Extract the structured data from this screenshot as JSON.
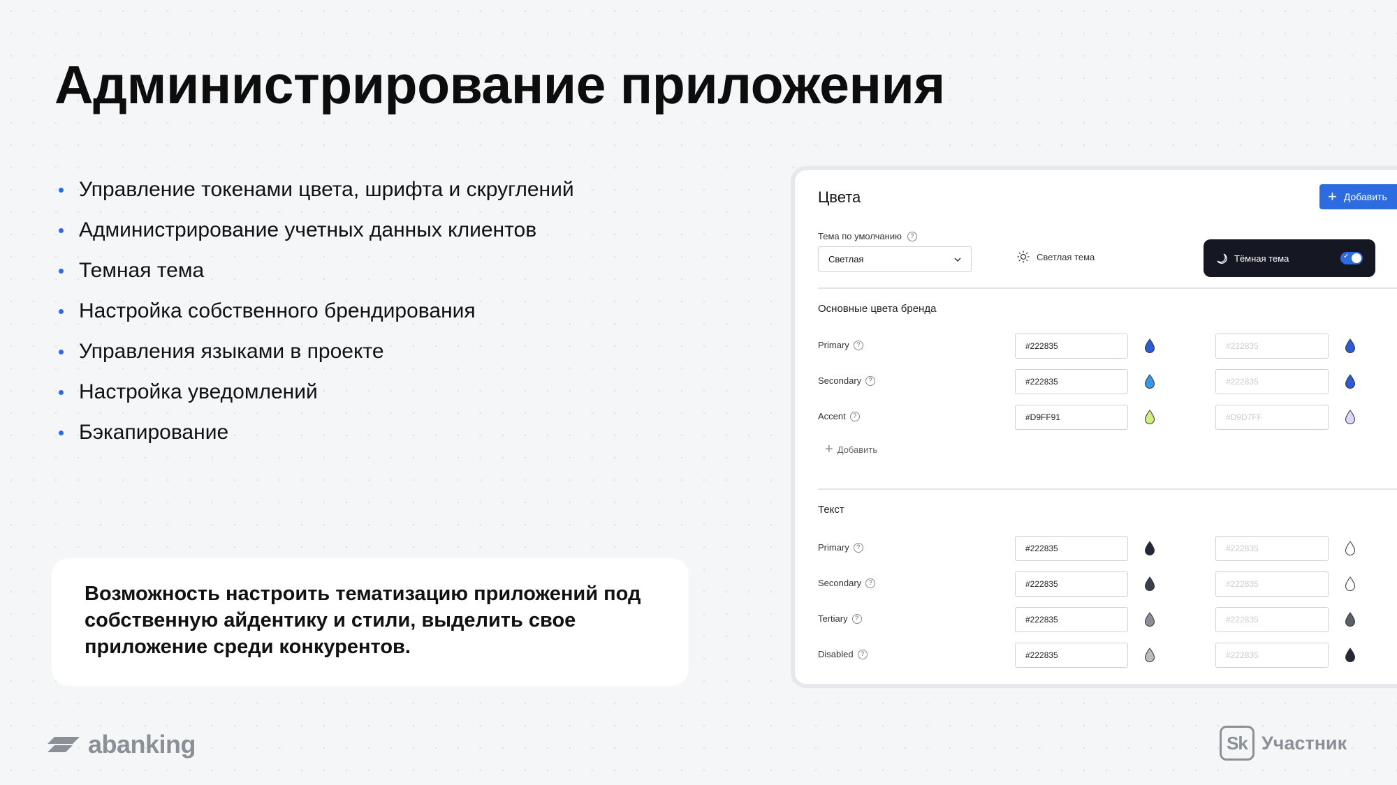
{
  "page": {
    "title": "Администрирование приложения",
    "bullets": [
      "Управление токенами цвета, шрифта и скруглений",
      "Администрирование учетных данных клиентов",
      "Темная тема",
      "Настройка собственного брендирования",
      "Управления языками в проекте",
      "Настройка уведомлений",
      "Бэкапирование"
    ],
    "note": "Возможность настроить тематизацию приложений под собственную айдентику и стили, выделить свое приложение среди конкурентов.",
    "logo_left": "abanking",
    "logo_right_mark": "Sk",
    "logo_right_text": "Участник"
  },
  "panel": {
    "title": "Цвета",
    "add_button": "Добавить",
    "theme_label": "Тема по умолчанию",
    "help_symbol": "?",
    "theme_select_value": "Светлая",
    "light_theme_label": "Светлая тема",
    "dark_theme_label": "Тёмная тема",
    "dark_theme_enabled": true,
    "brand_section": {
      "title": "Основные цвета бренда",
      "rows": [
        {
          "name": "Primary",
          "value": "#222835",
          "alt_value": "#222835",
          "swatch": "#2d5bd6",
          "alt_swatch": "#2d5bd6"
        },
        {
          "name": "Secondary",
          "value": "#222835",
          "alt_value": "#222835",
          "swatch": "#3a96e6",
          "alt_swatch": "#2d5bd6"
        },
        {
          "name": "Accent",
          "value": "#D9FF91",
          "alt_value": "#D9D7FF",
          "swatch": "#cdf07a",
          "alt_swatch": "#d9d7ff"
        }
      ],
      "add_label": "Добавить"
    },
    "text_section": {
      "title": "Текст",
      "rows": [
        {
          "name": "Primary",
          "value": "#222835",
          "alt_value": "#222835",
          "swatch": "#222835",
          "alt_swatch": "#ffffff"
        },
        {
          "name": "Secondary",
          "value": "#222835",
          "alt_value": "#222835",
          "swatch": "#3a3f4b",
          "alt_swatch": "#ffffff"
        },
        {
          "name": "Tertiary",
          "value": "#222835",
          "alt_value": "#222835",
          "swatch": "#8a8e96",
          "alt_swatch": "#5b5f68"
        },
        {
          "name": "Disabled",
          "value": "#222835",
          "alt_value": "#222835",
          "swatch": "#b8bbc1",
          "alt_swatch": "#222835"
        }
      ]
    }
  },
  "colors": {
    "accent_blue": "#2d6be0",
    "dark_card": "#151823"
  }
}
